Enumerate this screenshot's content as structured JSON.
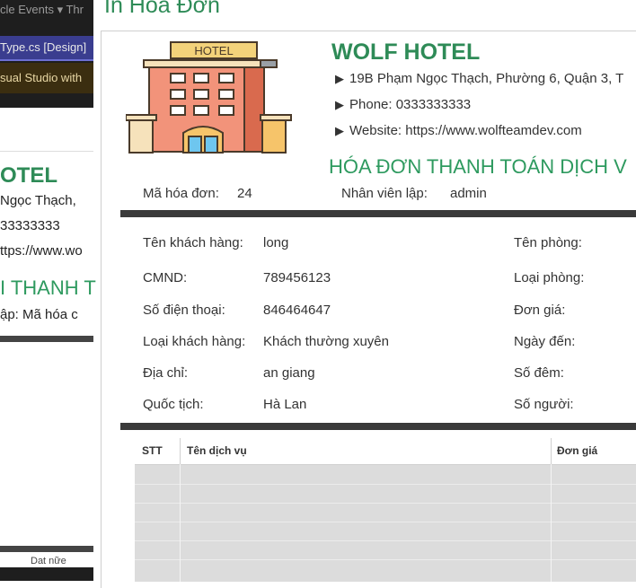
{
  "background": {
    "menu_text": "cle Events ▾  Thr",
    "tab_text": "Type.cs [Design]",
    "banner_text": "sual Studio with",
    "ghost_title": "OTEL",
    "ghost_lines": [
      " Ngọc Thạch,",
      "33333333",
      "ttps://www.wo"
    ],
    "ghost_subtitle": "I THANH T",
    "ghost_meta": "ập:   Mã hóa c",
    "ghost_tab": "Dat nữe"
  },
  "window": {
    "title": "In Hóa Đơn"
  },
  "hotel": {
    "name": "WOLF HOTEL",
    "address": "19B Phạm Ngọc Thạch, Phường 6, Quận 3, T",
    "phone": "Phone: 0333333333",
    "website": "Website: https://www.wolfteamdev.com",
    "logo_sign": "HOTEL"
  },
  "invoice": {
    "heading": "HÓA ĐƠN THANH TOÁN DỊCH V",
    "id_label": "Mã hóa đơn:",
    "id_value": "24",
    "staff_label": "Nhân viên lập:",
    "staff_value": "admin"
  },
  "customer": {
    "name_label": "Tên khách hàng:",
    "name_value": "long",
    "cmnd_label": "CMND:",
    "cmnd_value": "789456123",
    "phone_label": "Số điện thoại:",
    "phone_value": "846464647",
    "type_label": "Loại khách hàng:",
    "type_value": "Khách thường xuyên",
    "address_label": "Địa chỉ:",
    "address_value": "an giang",
    "nationality_label": "Quốc tịch:",
    "nationality_value": "Hà Lan"
  },
  "room": {
    "name_label": "Tên phòng:",
    "type_label": "Loại phòng:",
    "price_label": "Đơn giá:",
    "arrival_label": "Ngày đến:",
    "nights_label": "Số đêm:",
    "people_label": "Số người:"
  },
  "services_table": {
    "columns": [
      "STT",
      "Tên dịch vụ",
      "Đơn giá"
    ]
  },
  "colors": {
    "accent_green": "#2e8b57",
    "bar_dark": "#3a3a3a",
    "table_row": "#dcdcdc"
  },
  "icons": {
    "bullet": "triangle-right-icon",
    "logo": "hotel-building-icon"
  }
}
